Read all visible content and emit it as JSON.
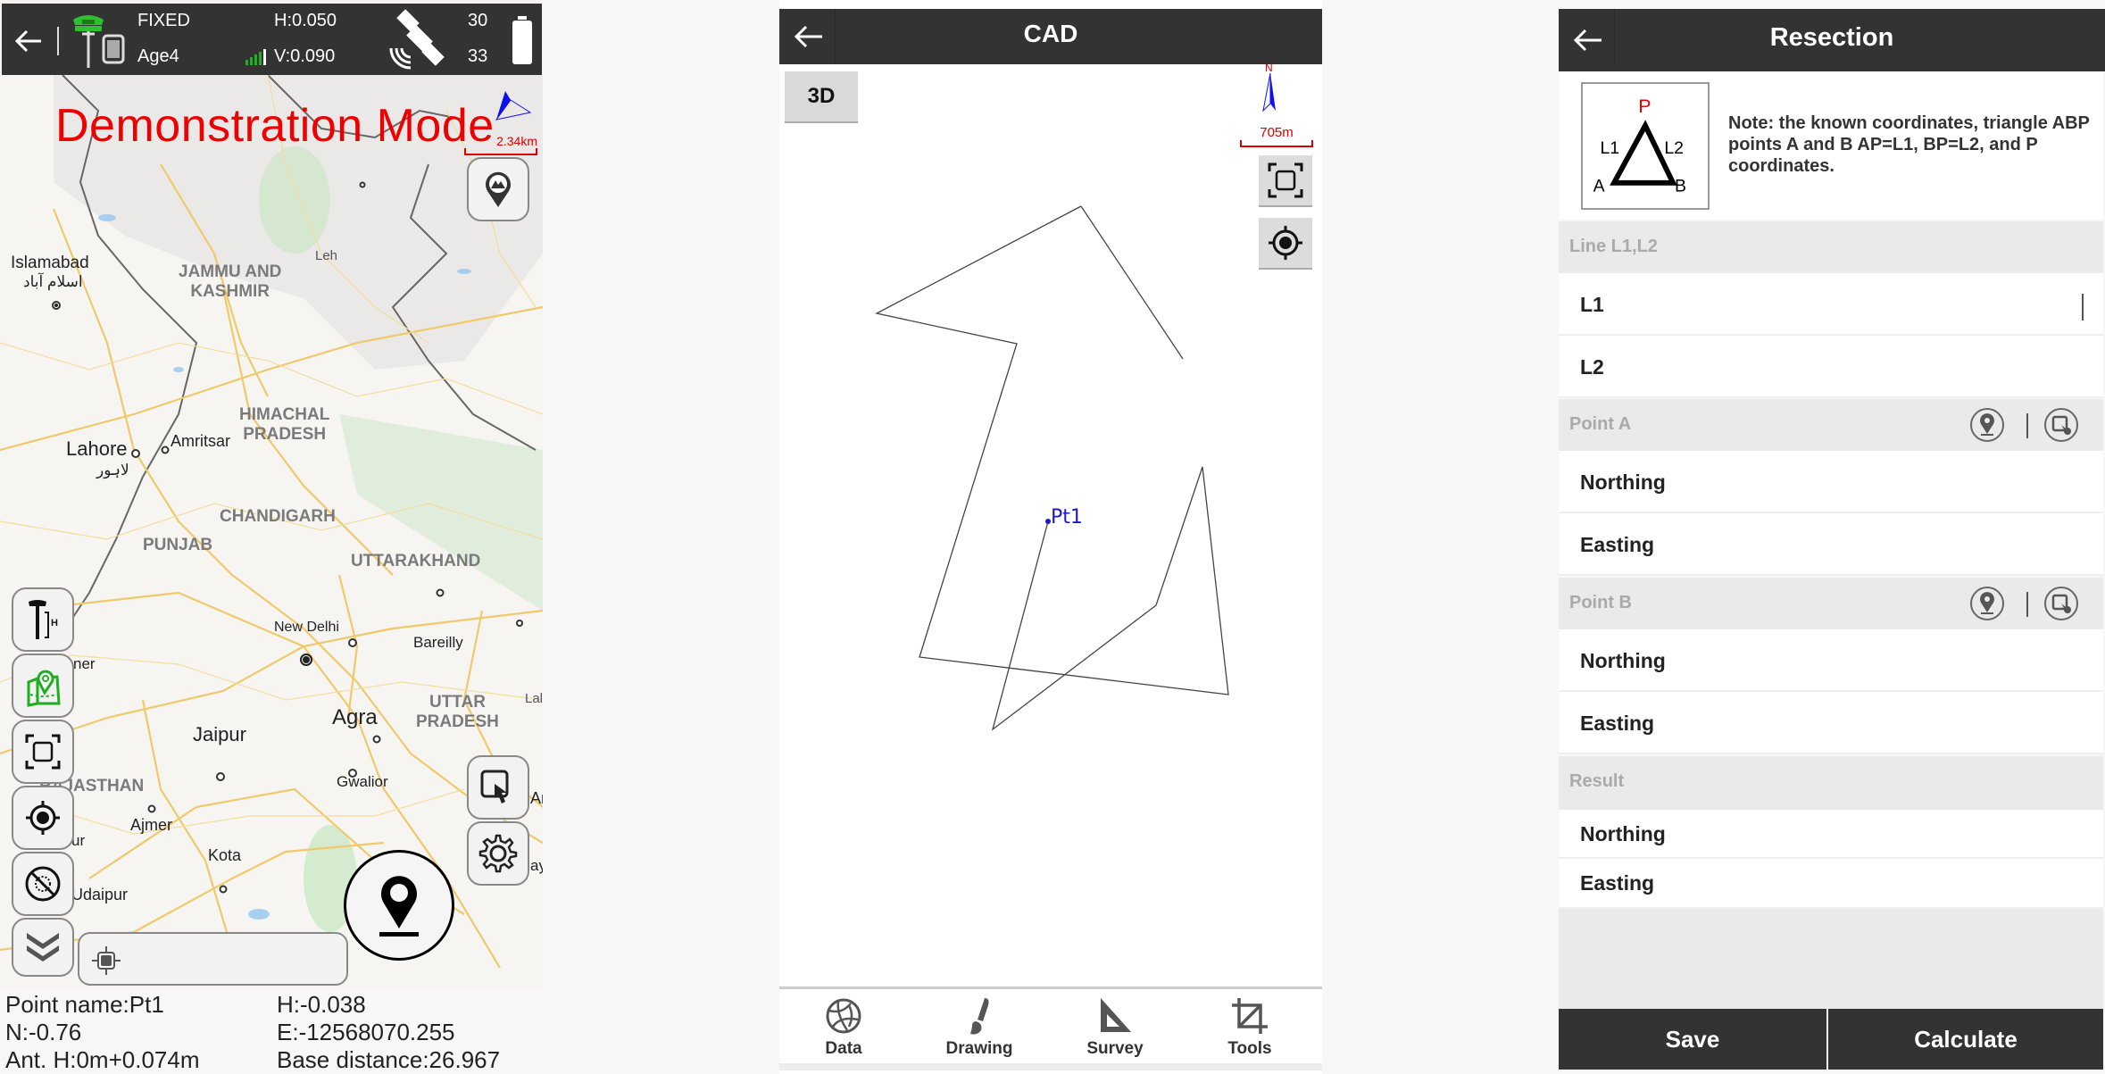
{
  "map_screen": {
    "status": {
      "solution": "FIXED",
      "age": "Age4",
      "h_precision": "H:0.050",
      "v_precision": "V:0.090",
      "sats_used": "30",
      "sats_visible": "33",
      "signal_color": "#22b022"
    },
    "demo_banner": "Demonstration Mode",
    "scale": "2.34km",
    "map_labels": {
      "islamabad": "Islamabad",
      "islamabad_urdu": "اسلام آباد",
      "jammu": "JAMMU AND\nKASHMIR",
      "leh": "Leh",
      "himachal": "HIMACHAL\nPRADESH",
      "lahore": "Lahore",
      "lahore_urdu": "لاہور",
      "amritsar": "Amritsar",
      "chandigarh": "CHANDIGARH",
      "punjab": "PUNJAB",
      "uttarakhand": "UTTARAKHAND",
      "new_delhi": "New Delhi",
      "bareilly": "Bareilly",
      "uttar_pradesh": "UTTAR\nPRADESH",
      "agra": "Agra",
      "jaipur": "Jaipur",
      "gwalior": "Gwalior",
      "rajasthan": "RAJASTHAN",
      "ajmer": "Ajmer",
      "kota": "Kota",
      "udaipur": "Udaipur",
      "bikaner_partial": "ner",
      "lal_partial": "Lal",
      "ur_partial": "ur",
      "an_partial": "An",
      "ay_partial": "ay"
    },
    "info": {
      "point_name": "Point name:Pt1",
      "h": "H:-0.038",
      "n": "N:-0.76",
      "e": "E:-12568070.255",
      "ant_h": "Ant. H:0m+0.074m",
      "base_distance": "Base distance:26.967"
    }
  },
  "cad_screen": {
    "title": "CAD",
    "btn_3d": "3D",
    "compass_n": "N",
    "scale": "705m",
    "point_label": "Pt1",
    "point_color": "#1a1acc",
    "nav": [
      {
        "label": "Data",
        "icon": "globe-network-icon"
      },
      {
        "label": "Drawing",
        "icon": "brush-icon"
      },
      {
        "label": "Survey",
        "icon": "set-square-icon"
      },
      {
        "label": "Tools",
        "icon": "crop-icon"
      }
    ]
  },
  "resection_screen": {
    "title": "Resection",
    "diagram": {
      "p": "P",
      "l1": "L1",
      "l2": "L2",
      "a": "A",
      "b": "B"
    },
    "note": "Note: the known coordinates, triangle ABP points A and B AP=L1, BP=L2, and P coordinates.",
    "sections": {
      "lines": "Line L1,L2",
      "point_a": "Point A",
      "point_b": "Point B",
      "result": "Result"
    },
    "fields": {
      "l1": {
        "label": "L1",
        "value": ""
      },
      "l2": {
        "label": "L2",
        "value": ""
      },
      "a_northing": {
        "label": "Northing",
        "value": ""
      },
      "a_easting": {
        "label": "Easting",
        "value": ""
      },
      "b_northing": {
        "label": "Northing",
        "value": ""
      },
      "b_easting": {
        "label": "Easting",
        "value": ""
      },
      "r_northing": {
        "label": "Northing",
        "value": ""
      },
      "r_easting": {
        "label": "Easting",
        "value": ""
      }
    },
    "save": "Save",
    "calculate": "Calculate"
  }
}
